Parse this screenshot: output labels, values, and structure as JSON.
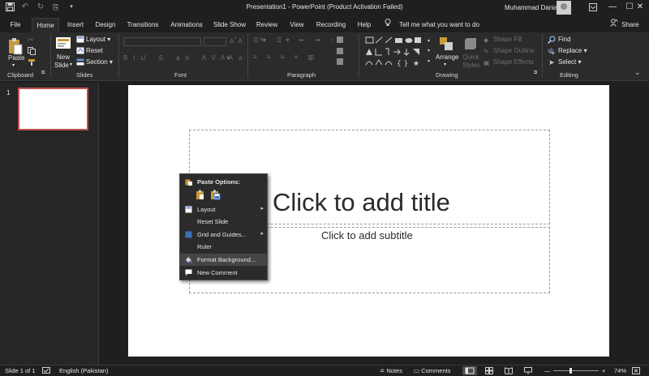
{
  "window": {
    "title": "Presentation1  -  PowerPoint (Product Activation Failed)",
    "user": "Muhammad Danial",
    "minimize": "—",
    "maximize": "☐",
    "close": "✕"
  },
  "qat": {
    "save_icon": "save-icon",
    "undo_icon": "undo-icon",
    "redo_icon": "redo-icon",
    "customize_icon": "customize-icon"
  },
  "tabs": [
    {
      "label": "File"
    },
    {
      "label": "Home"
    },
    {
      "label": "Insert"
    },
    {
      "label": "Design"
    },
    {
      "label": "Transitions"
    },
    {
      "label": "Animations"
    },
    {
      "label": "Slide Show"
    },
    {
      "label": "Review"
    },
    {
      "label": "View"
    },
    {
      "label": "Recording"
    },
    {
      "label": "Help"
    }
  ],
  "tell_me": "Tell me what you want to do",
  "share": "Share",
  "ribbon": {
    "clipboard": {
      "label": "Clipboard",
      "paste": "Paste"
    },
    "slides": {
      "label": "Slides",
      "new_slide_1": "New",
      "new_slide_2": "Slide",
      "layout": "Layout",
      "reset": "Reset",
      "section": "Section"
    },
    "font": {
      "label": "Font"
    },
    "paragraph": {
      "label": "Paragraph"
    },
    "drawing": {
      "label": "Drawing",
      "arrange": "Arrange",
      "quick_styles_1": "Quick",
      "quick_styles_2": "Styles",
      "shape_fill": "Shape Fill",
      "shape_outline": "Shape Outline",
      "shape_effects": "Shape Effects"
    },
    "editing": {
      "label": "Editing",
      "find": "Find",
      "replace": "Replace",
      "select": "Select"
    }
  },
  "thumbnails": [
    {
      "number": "1"
    }
  ],
  "slide": {
    "title_placeholder": "Click to add title",
    "subtitle_placeholder": "Click to add subtitle"
  },
  "context_menu": {
    "paste_options": "Paste Options:",
    "items": [
      {
        "label": "Layout",
        "has_submenu": true
      },
      {
        "label": "Reset Slide",
        "has_submenu": false
      },
      {
        "label": "Grid and Guides...",
        "has_submenu": true
      },
      {
        "label": "Ruler",
        "has_submenu": false
      },
      {
        "label": "Format Background...",
        "has_submenu": false
      },
      {
        "label": "New Comment",
        "has_submenu": false
      }
    ]
  },
  "status": {
    "slide_of": "Slide 1 of 1",
    "language": "English (Pakistan)",
    "notes": "Notes",
    "comments": "Comments",
    "zoom_minus": "—",
    "zoom_plus": "+",
    "zoom": "74%"
  },
  "colors": {
    "app_bg": "#1f1f1f",
    "ribbon_bg": "#2b2b2b",
    "selection_border": "#c0504d",
    "slide_bg": "#ffffff"
  }
}
